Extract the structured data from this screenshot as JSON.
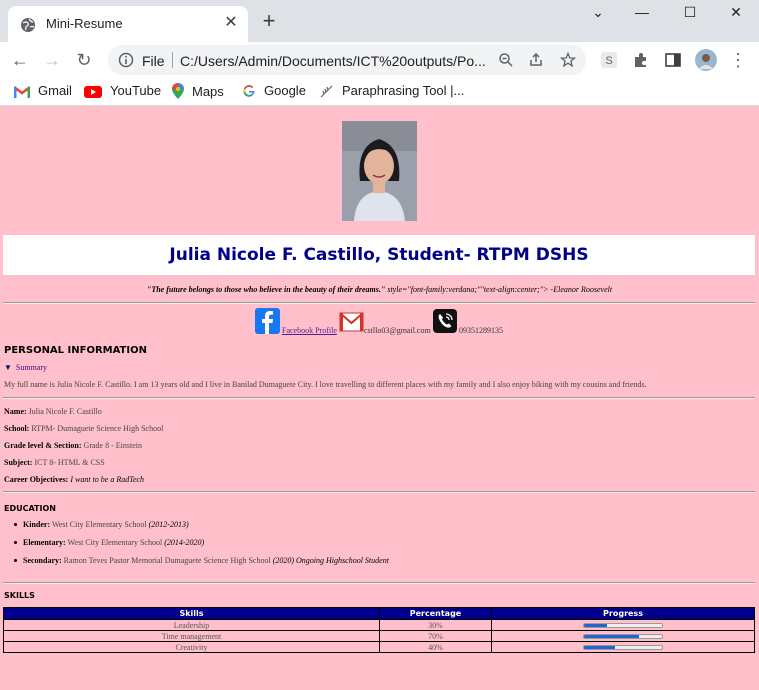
{
  "browser": {
    "tab_title": "Mini-Resume",
    "address_scheme": "File",
    "address_url": "C:/Users/Admin/Documents/ICT%20outputs/Po...",
    "bookmarks": [
      "Gmail",
      "YouTube",
      "Maps",
      "Google",
      "Paraphrasing Tool |..."
    ]
  },
  "header": {
    "name": "Julia Nicole F. Castillo, Student- RTPM DSHS",
    "quote_bold": "\"The future belongs to those who believe in the beauty of their dreams.\"",
    "quote_rest": " style=\"font-family:verdana;\"\"text-align:center;\"> -Eleanor Roosevelt"
  },
  "contact": {
    "facebook": "Facebook Profile",
    "email": "cstllo03@gmail.com",
    "phone": "09351289135"
  },
  "personal": {
    "heading": "PERSONAL INFORMATION",
    "summary_label": "Summary",
    "bio": "My full name is Julia Nicole F. Castillo. I am 13 years old and I live in Banilad Dumaguete City. I love travelling to different places with my family and I also enjoy biking with my cousins and friends.",
    "fields": [
      {
        "label": "Name:",
        "value": " Julia Nicole F. Castillo"
      },
      {
        "label": "School:",
        "value": " RTPM- Dumaguete Science High School"
      },
      {
        "label": "Grade level & Section:",
        "value": " Grade 8 - Einstein"
      },
      {
        "label": "Subject:",
        "value": " ICT 8- HTML & CSS"
      },
      {
        "label": "Career Objectives:",
        "value": " I want to be a RadTech"
      }
    ]
  },
  "education": {
    "heading": "EDUCATION",
    "items": [
      {
        "label": "Kinder:",
        "school": " West City Elementary School ",
        "years": "(2012-2013)"
      },
      {
        "label": "Elementary:",
        "school": " West City Elementary School ",
        "years": "(2014-2020)"
      },
      {
        "label": "Secondary:",
        "school": " Ramon Teves Pastor Memorial Dumaguete Science High School ",
        "years": "(2020) Ongoing Highschool Student"
      }
    ]
  },
  "skills": {
    "heading": "SKILLS",
    "columns": [
      "Skills",
      "Percentage",
      "Progress"
    ],
    "rows": [
      {
        "skill": "Leadership",
        "percentage": "30%",
        "progress": 0.3
      },
      {
        "skill": "Time management",
        "percentage": "70%",
        "progress": 0.7
      },
      {
        "skill": "Creativity",
        "percentage": "40%",
        "progress": 0.4
      }
    ]
  },
  "colors": {
    "page_bg": "#ffc0cb",
    "name_color": "#00008b",
    "table_header": "#00008b",
    "progress_fill": "#1f66d1"
  }
}
